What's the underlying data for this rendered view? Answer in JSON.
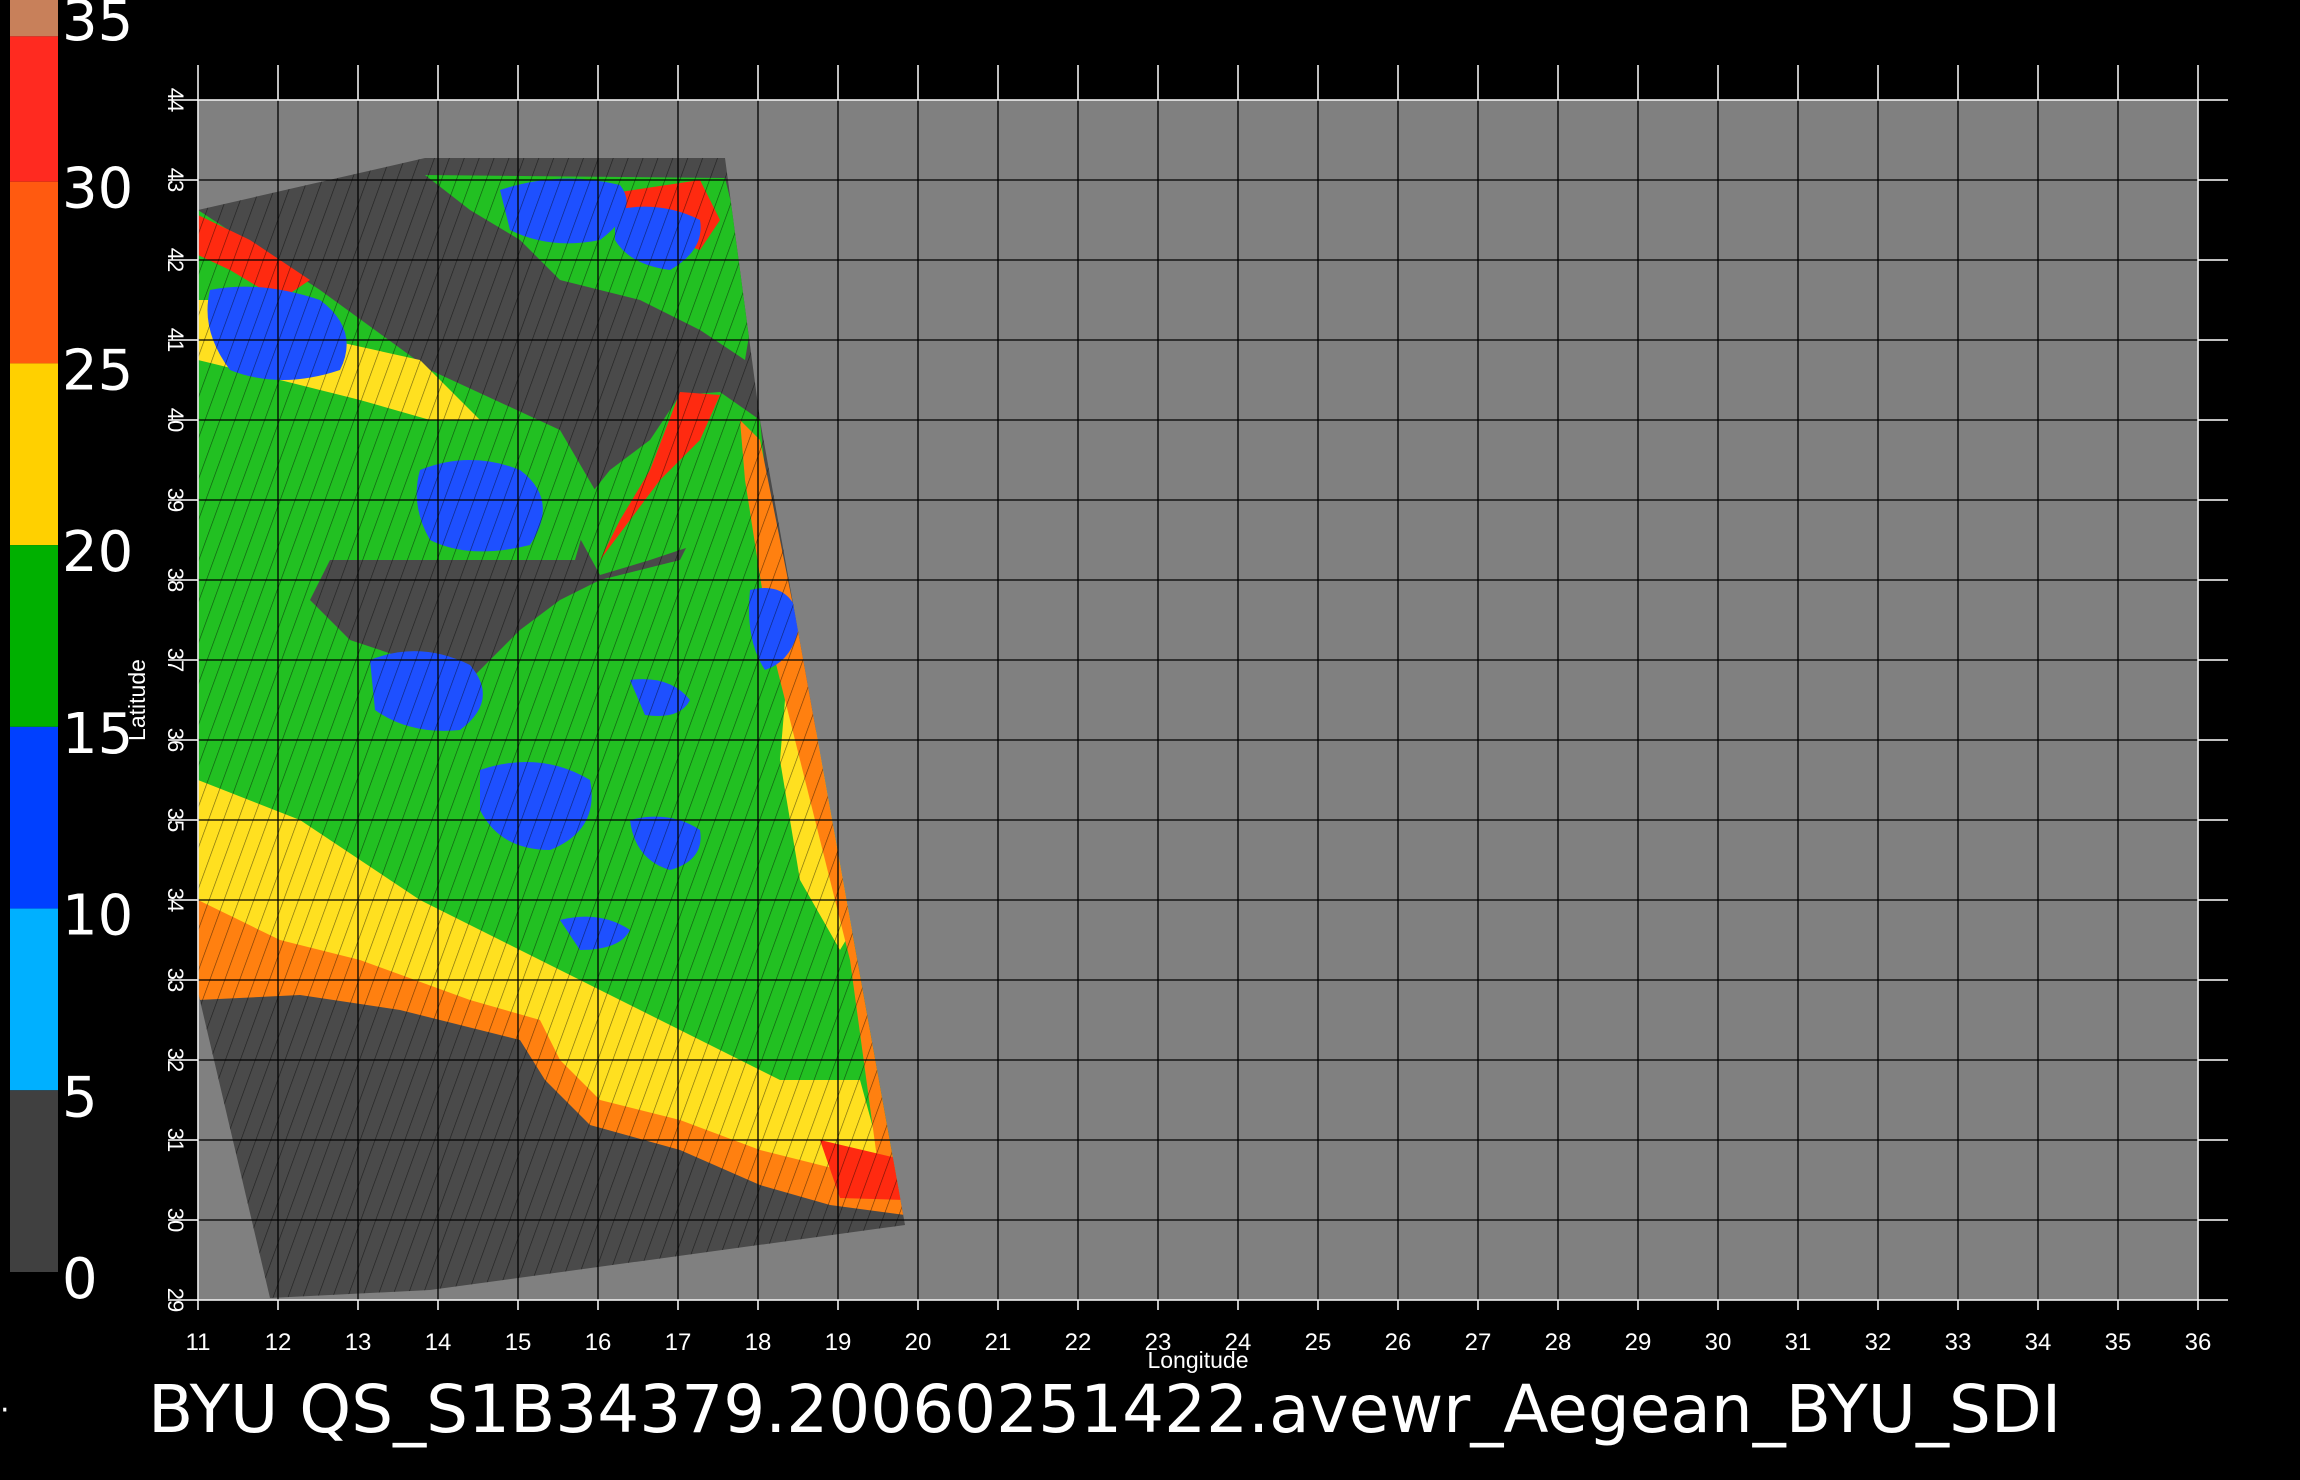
{
  "title": "BYU  QS_S1B34379.20060251422.avewr_Aegean_BYU_SDI",
  "xlabel": "Longitude",
  "ylabel": "Latitude",
  "colorbar": {
    "labels": [
      "35",
      "30",
      "25",
      "20",
      "15",
      "10",
      "5",
      "0"
    ],
    "bands": [
      {
        "from": 35,
        "to": 34,
        "color": "#c8805a"
      },
      {
        "from": 34,
        "to": 30,
        "color": "#ff2a20"
      },
      {
        "from": 30,
        "to": 25,
        "color": "#ff5a10"
      },
      {
        "from": 25,
        "to": 20,
        "color": "#ffd000"
      },
      {
        "from": 20,
        "to": 15,
        "color": "#00b000"
      },
      {
        "from": 15,
        "to": 10,
        "color": "#0040ff"
      },
      {
        "from": 10,
        "to": 5,
        "color": "#00b0ff"
      },
      {
        "from": 5,
        "to": 0,
        "color": "#404040"
      }
    ]
  },
  "map": {
    "lon_range": [
      11,
      36
    ],
    "lat_range": [
      29,
      44
    ],
    "lon_ticks": [
      "11",
      "12",
      "13",
      "14",
      "15",
      "16",
      "17",
      "18",
      "19",
      "20",
      "21",
      "22",
      "23",
      "24",
      "25",
      "26",
      "27",
      "28",
      "29",
      "30",
      "31",
      "32",
      "33",
      "34",
      "35",
      "36"
    ],
    "lat_ticks": [
      "29",
      "30",
      "31",
      "32",
      "33",
      "34",
      "35",
      "36",
      "37",
      "38",
      "39",
      "40",
      "41",
      "42",
      "43",
      "44"
    ],
    "background_color": "#808080",
    "swath_color": "#4a4a4a",
    "grid_color": "#000000",
    "grid": true
  },
  "colors": {
    "label": "#ffffff",
    "green": "#22c022",
    "blue": "#1e50ff",
    "yellow": "#ffe020",
    "orange": "#ff8010",
    "red": "#ff2a10"
  }
}
